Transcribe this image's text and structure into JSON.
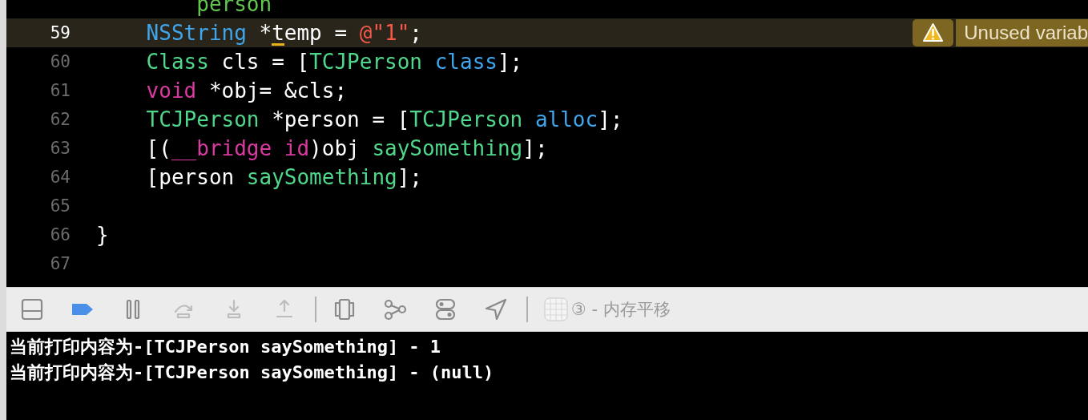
{
  "editor": {
    "lines": [
      {
        "tokens": [
          {
            "text": "        person",
            "kind": "var"
          }
        ],
        "current": false
      },
      {
        "number": "59",
        "current": true,
        "tokens": [
          {
            "text": "    NSString",
            "kind": "type"
          },
          {
            "text": " *",
            "kind": "plain"
          },
          {
            "text": "t",
            "kind": "flagged"
          },
          {
            "text": "emp = ",
            "kind": "plain"
          },
          {
            "text": "@\"1\"",
            "kind": "string"
          },
          {
            "text": ";",
            "kind": "plain"
          }
        ],
        "warning": "Unused variab"
      },
      {
        "number": "60",
        "current": false,
        "tokens": [
          {
            "text": "    Class",
            "kind": "class"
          },
          {
            "text": " cls = [",
            "kind": "plain"
          },
          {
            "text": "TCJPerson",
            "kind": "class"
          },
          {
            "text": " class",
            "kind": "type"
          },
          {
            "text": "];",
            "kind": "plain"
          }
        ]
      },
      {
        "number": "61",
        "current": false,
        "tokens": [
          {
            "text": "    void",
            "kind": "keyword"
          },
          {
            "text": " *obj= &cls;",
            "kind": "plain"
          }
        ]
      },
      {
        "number": "62",
        "current": false,
        "tokens": [
          {
            "text": "    TCJPerson",
            "kind": "class"
          },
          {
            "text": " *person = [",
            "kind": "plain"
          },
          {
            "text": "TCJPerson",
            "kind": "class"
          },
          {
            "text": " alloc",
            "kind": "type"
          },
          {
            "text": "];",
            "kind": "plain"
          }
        ]
      },
      {
        "number": "63",
        "current": false,
        "tokens": [
          {
            "text": "    [(",
            "kind": "plain"
          },
          {
            "text": "__bridge id",
            "kind": "keyword"
          },
          {
            "text": ")obj ",
            "kind": "plain"
          },
          {
            "text": "saySomething",
            "kind": "class"
          },
          {
            "text": "];",
            "kind": "plain"
          }
        ]
      },
      {
        "number": "64",
        "current": false,
        "tokens": [
          {
            "text": "    [person ",
            "kind": "plain"
          },
          {
            "text": "saySomething",
            "kind": "class"
          },
          {
            "text": "];",
            "kind": "plain"
          }
        ]
      },
      {
        "number": "65",
        "current": false
      },
      {
        "number": "66",
        "current": false,
        "tokens": [
          {
            "text": "}",
            "kind": "plain"
          }
        ]
      },
      {
        "number": "67",
        "current": false
      }
    ]
  },
  "debug_bar": {
    "buttons": [
      {
        "kind": "panel",
        "active": false,
        "disabled": false
      },
      {
        "kind": "breakpoints",
        "active": true,
        "disabled": false
      },
      {
        "kind": "pause",
        "active": false,
        "disabled": false
      },
      {
        "kind": "step-over",
        "active": false,
        "disabled": true
      },
      {
        "kind": "step-into",
        "active": false,
        "disabled": true
      },
      {
        "kind": "step-out",
        "active": false,
        "disabled": true
      },
      {
        "kind": "divider"
      },
      {
        "kind": "view-debugger",
        "active": false,
        "disabled": false
      },
      {
        "kind": "memory-graph",
        "active": false,
        "disabled": false
      },
      {
        "kind": "environment",
        "active": false,
        "disabled": false
      },
      {
        "kind": "location",
        "active": false,
        "disabled": false
      },
      {
        "kind": "divider"
      }
    ],
    "process": "③ - 内存平移"
  },
  "console": {
    "lines": [
      "当前打印内容为-[TCJPerson saySomething] - 1",
      "当前打印内容为-[TCJPerson saySomething] - (null)"
    ]
  }
}
